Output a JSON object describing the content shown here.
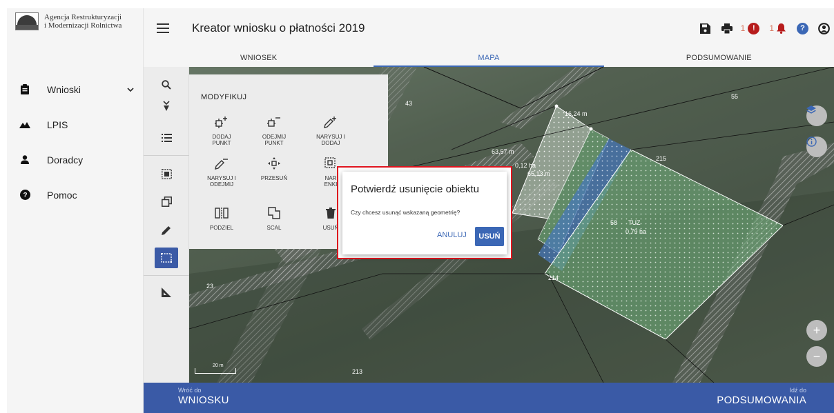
{
  "logo": {
    "line1": "Agencja Restrukturyzacji",
    "line2": "i Modernizacji Rolnictwa"
  },
  "header": {
    "title": "Kreator wniosku o płatności 2019",
    "error_count": "1",
    "alert_count": "1"
  },
  "sidebar": {
    "items": [
      {
        "label": "Wnioski",
        "icon": "clipboard-icon"
      },
      {
        "label": "LPIS",
        "icon": "mountain-icon"
      },
      {
        "label": "Doradcy",
        "icon": "person-icon"
      },
      {
        "label": "Pomoc",
        "icon": "help-icon"
      }
    ]
  },
  "tabs": [
    {
      "label": "WNIOSEK"
    },
    {
      "label": "MAPA"
    },
    {
      "label": "PODSUMOWANIE"
    }
  ],
  "panel": {
    "title": "MODYFIKUJ",
    "buttons": [
      {
        "label1": "DODAJ",
        "label2": "PUNKT"
      },
      {
        "label1": "ODEJMIJ",
        "label2": "PUNKT"
      },
      {
        "label1": "NARYSUJ I",
        "label2": "DODAJ"
      },
      {
        "label1": "NARYSUJ I",
        "label2": "ODEJMIJ"
      },
      {
        "label1": "PRZESUŃ",
        "label2": ""
      },
      {
        "label1": "NAR",
        "label2": "ENKI"
      },
      {
        "label1": "PODZIEL",
        "label2": ""
      },
      {
        "label1": "SCAL",
        "label2": ""
      },
      {
        "label1": "USUŃ",
        "label2": ""
      }
    ]
  },
  "map": {
    "labels": {
      "l43": "43",
      "l55": "55",
      "l215": "215",
      "l214": "214",
      "l213": "213",
      "l23": "23",
      "l58": "58",
      "tuz": "TUZ",
      "area1": "0,79 ha",
      "area2": "0,12 ha",
      "m1": "16,24 m",
      "m2": "63,57 m",
      "m3": "65,13 m"
    },
    "scale": "20 m"
  },
  "dialog": {
    "title": "Potwierdź usunięcie obiektu",
    "message": "Czy chcesz usunąć wskazaną geometrię?",
    "cancel": "ANULUJ",
    "confirm": "USUŃ"
  },
  "bottom": {
    "back_small": "Wróć do",
    "back_big": "WNIOSKU",
    "next_small": "Idź do",
    "next_big": "PODSUMOWANIA"
  },
  "colors": {
    "accent": "#3b67b5",
    "bottombar": "#3a5aa6",
    "error": "#b71c1c",
    "highlight_frame": "#e0141e"
  }
}
